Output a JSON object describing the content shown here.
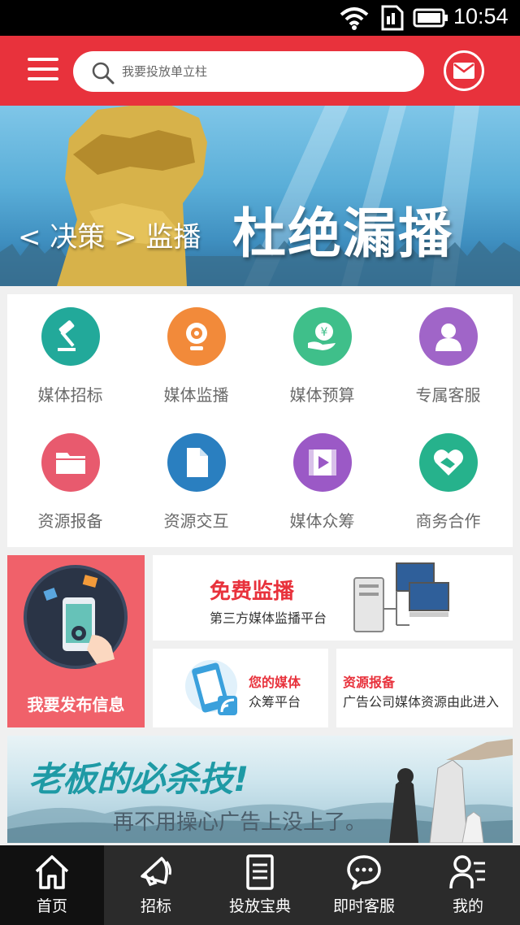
{
  "status_bar": {
    "time": "10:54"
  },
  "header": {
    "search_placeholder": "我要投放单立柱"
  },
  "banner": {
    "small_text": "< 决策 > 监播",
    "big_text": "杜绝漏播"
  },
  "grid": [
    {
      "label": "媒体招标",
      "icon": "gavel-icon",
      "color": "#22a99a"
    },
    {
      "label": "媒体监播",
      "icon": "webcam-icon",
      "color": "#f28a3a"
    },
    {
      "label": "媒体预算",
      "icon": "yen-hand-icon",
      "color": "#3fbf8a"
    },
    {
      "label": "专属客服",
      "icon": "user-icon",
      "color": "#a065c8"
    },
    {
      "label": "资源报备",
      "icon": "folder-icon",
      "color": "#e85a6e"
    },
    {
      "label": "资源交互",
      "icon": "document-icon",
      "color": "#2a7fc0"
    },
    {
      "label": "媒体众筹",
      "icon": "video-icon",
      "color": "#9b59c6"
    },
    {
      "label": "商务合作",
      "icon": "handshake-icon",
      "color": "#26b28c"
    }
  ],
  "promos": {
    "publish": {
      "label": "我要发布信息"
    },
    "monitor": {
      "title": "免费监播",
      "subtitle": "第三方媒体监播平台"
    },
    "crowd": {
      "title": "您的媒体",
      "subtitle": "众筹平台"
    },
    "resource": {
      "title": "资源报备",
      "subtitle": "广告公司媒体资源由此进入"
    }
  },
  "ad_banner": {
    "headline": "老板的必杀技!",
    "subline": "再不用操心广告上没上了。"
  },
  "tabs": [
    {
      "label": "首页",
      "icon": "home-icon",
      "active": true
    },
    {
      "label": "招标",
      "icon": "megaphone-icon",
      "active": false
    },
    {
      "label": "投放宝典",
      "icon": "notebook-icon",
      "active": false
    },
    {
      "label": "即时客服",
      "icon": "chat-icon",
      "active": false
    },
    {
      "label": "我的",
      "icon": "profile-icon",
      "active": false
    }
  ],
  "colors": {
    "brand_red": "#e8323c",
    "tabbar_bg": "#2b2b2b",
    "headline_teal": "#1e9aa5"
  }
}
